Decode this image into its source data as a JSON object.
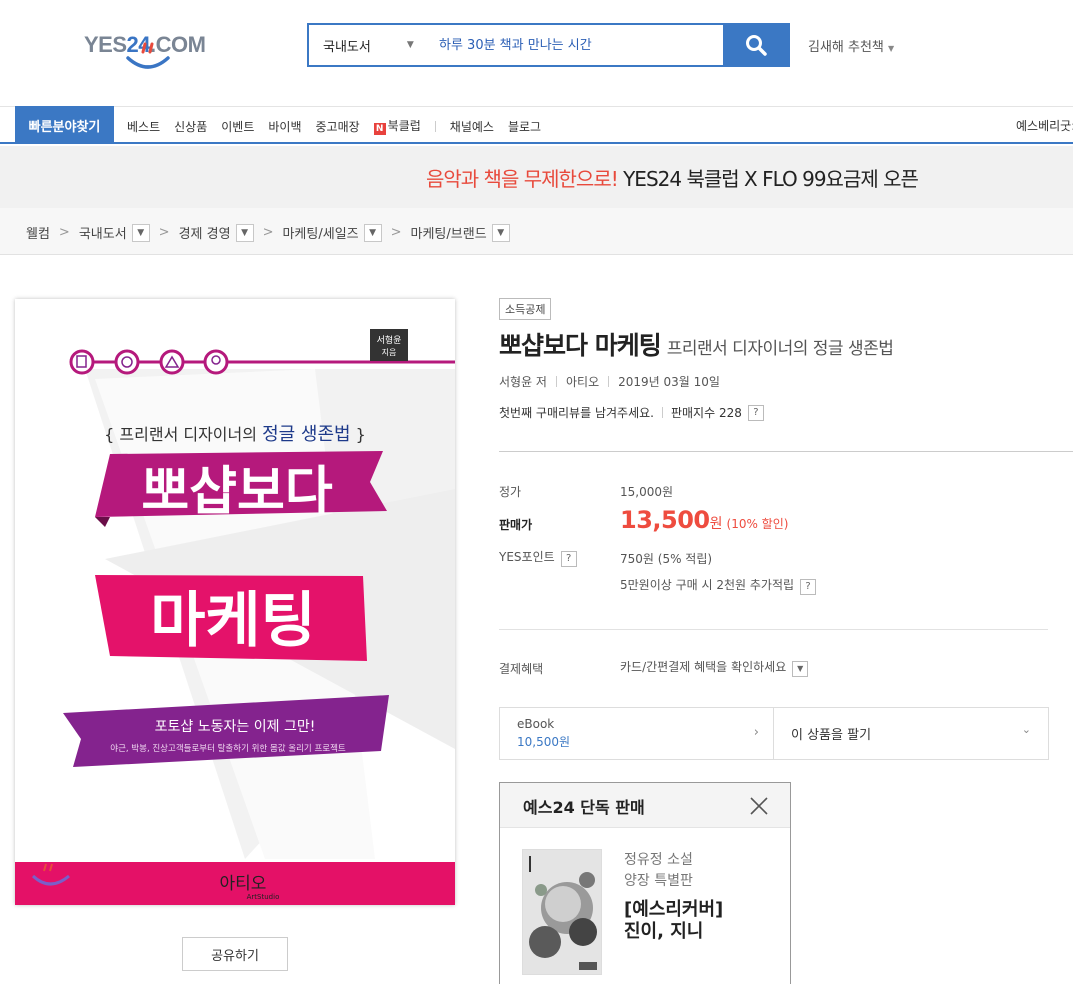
{
  "header": {
    "logo_text_left": "YES",
    "logo_text_num": "24",
    "logo_text_right": ".COM",
    "search_category": "국내도서",
    "search_placeholder": "하루 30분 책과 만나는 시간",
    "recommend_label": "김새해 추천책"
  },
  "gnb": {
    "category_button": "빠른분야찾기",
    "menu": [
      "베스트",
      "신상품",
      "이벤트",
      "바이백",
      "중고매장",
      "북클럽",
      "채널예스",
      "블로그"
    ],
    "n_badge": "N",
    "right_link": "예스베리굿:"
  },
  "banner": {
    "highlight": "음악과 책을 무제한으로!",
    "text": "YES24 북클럽 X FLO 99요금제 오픈"
  },
  "breadcrumb": [
    "웰컴",
    "국내도서",
    "경제 경영",
    "마케팅/세일즈",
    "마케팅/브랜드"
  ],
  "cover": {
    "author_tag_1": "서형윤",
    "author_tag_2": "지음",
    "subtitle": "{ 프리랜서 디자이너의 정글 생존법 }",
    "subtitle_plain": "{ 프리랜서 디자이너의 ",
    "subtitle_emph": "정글 생존법",
    "subtitle_close": " }",
    "title_1": "뽀샵보다",
    "title_2": "마케팅",
    "quote": "포토샵 노동자는 이제 그만!",
    "tagline": "야근, 박봉, 진상고객들로부터 탈출하기 위한 몸값 올리기 프로젝트",
    "publisher": "아티오",
    "publisher_sub": "ArtStudio",
    "colors": {
      "magenta": "#b5197c",
      "pink": "#e4126a",
      "purple": "#84238e",
      "footer": "#e41167"
    }
  },
  "share_button": "공유하기",
  "product": {
    "tag": "소득공제",
    "title": "뽀샵보다 마케팅",
    "subtitle": "프리랜서 디자이너의 정글 생존법",
    "author": "서형윤 저",
    "publisher": "아티오",
    "date": "2019년 03월 10일",
    "review_prompt": "첫번째 구매리뷰를 남겨주세요.",
    "sales_index": "판매지수 228",
    "help_icon_text": "?"
  },
  "price": {
    "list_label": "정가",
    "list_price": "15,000원",
    "sale_label": "판매가",
    "sale_price": "13,500",
    "sale_unit": "원",
    "discount": "(10% 할인)",
    "points_label": "YES포인트",
    "points": "750원 (5% 적립)",
    "points_extra": "5만원이상 구매 시 2천원 추가적립",
    "payment_label": "결제혜택",
    "payment_text": "카드/간편결제 혜택을 확인하세요"
  },
  "ebook": {
    "label": "eBook",
    "price": "10,500원",
    "sell_label": "이 상품을 팔기"
  },
  "exclusive": {
    "title": "예스24 단독 판매",
    "line1": "정유정 소설",
    "line2": "양장 특별판",
    "line3": "[예스리커버]",
    "line4": "진이, 지니"
  },
  "accent_colors": {
    "blue": "#3b78c4",
    "red": "#ee4c3f"
  }
}
